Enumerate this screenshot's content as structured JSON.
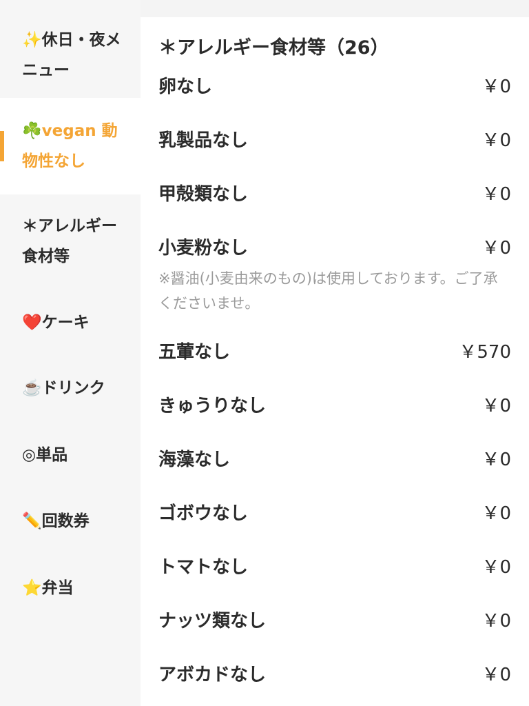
{
  "sidebar": {
    "items": [
      {
        "label": "✨休日・夜メニュー"
      },
      {
        "label": "☘️vegan 動物性なし"
      },
      {
        "label": "＊アレルギー食材等"
      },
      {
        "label": "❤️ケーキ"
      },
      {
        "label": "☕️ドリンク"
      },
      {
        "label": "◎単品"
      },
      {
        "label": "✏️回数券"
      },
      {
        "label": "⭐️弁当"
      }
    ],
    "active_index": 1
  },
  "section": {
    "title": "＊アレルギー食材等（26）"
  },
  "items": [
    {
      "name": "卵なし",
      "price": "￥0"
    },
    {
      "name": "乳製品なし",
      "price": "￥0"
    },
    {
      "name": "甲殻類なし",
      "price": "￥0"
    },
    {
      "name": "小麦粉なし",
      "price": "￥0",
      "note": "※醤油(小麦由来のもの)は使用しております。ご了承くださいませ。"
    },
    {
      "name": "五葷なし",
      "price": "￥570"
    },
    {
      "name": "きゅうりなし",
      "price": "￥0"
    },
    {
      "name": "海藻なし",
      "price": "￥0"
    },
    {
      "name": "ゴボウなし",
      "price": "￥0"
    },
    {
      "name": "トマトなし",
      "price": "￥0"
    },
    {
      "name": "ナッツ類なし",
      "price": "￥0"
    },
    {
      "name": "アボカドなし",
      "price": "￥0"
    }
  ],
  "colors": {
    "accent": "#f4a535",
    "sidebar_bg": "#f6f6f6",
    "main_bg": "#ffffff",
    "note_text": "#9a9a9a"
  }
}
